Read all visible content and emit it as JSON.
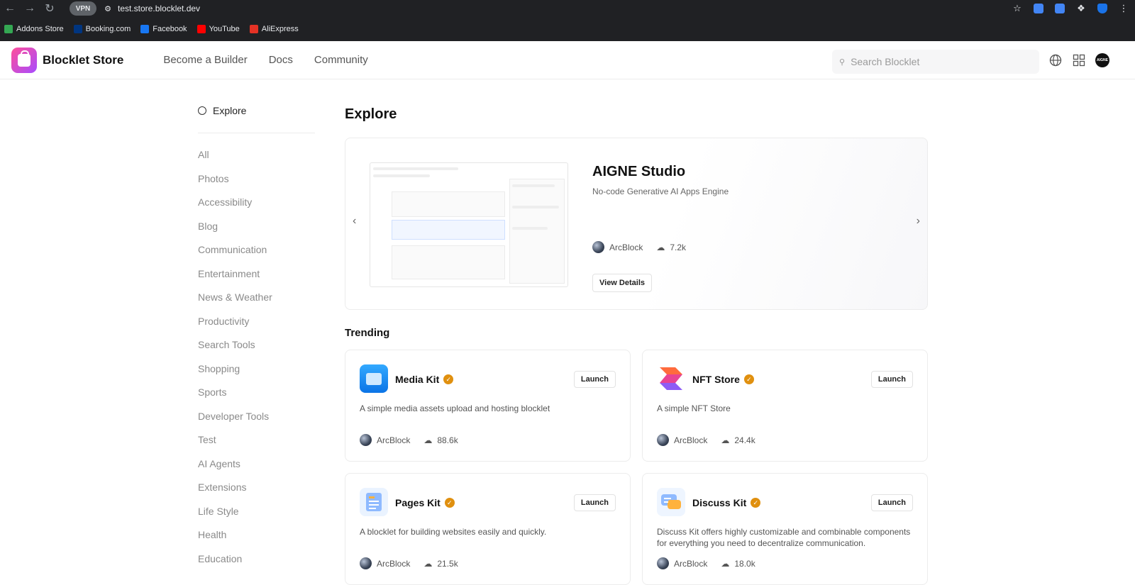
{
  "browser": {
    "vpn_label": "VPN",
    "url": "test.store.blocklet.dev",
    "bookmarks": [
      {
        "label": "Addons Store",
        "color": "#34a853"
      },
      {
        "label": "Booking.com",
        "color": "#003580"
      },
      {
        "label": "Facebook",
        "color": "#1877f2"
      },
      {
        "label": "YouTube",
        "color": "#ff0000"
      },
      {
        "label": "AliExpress",
        "color": "#e43225"
      }
    ]
  },
  "header": {
    "brand": "Blocklet Store",
    "nav": [
      "Become a Builder",
      "Docs",
      "Community"
    ],
    "search_placeholder": "Search Blocklet",
    "avatar_text": "AIGNE"
  },
  "sidebar": {
    "heading": "Explore",
    "categories": [
      "All",
      "Photos",
      "Accessibility",
      "Blog",
      "Communication",
      "Entertainment",
      "News & Weather",
      "Productivity",
      "Search Tools",
      "Shopping",
      "Sports",
      "Developer Tools",
      "Test",
      "AI Agents",
      "Extensions",
      "Life Style",
      "Health",
      "Education"
    ]
  },
  "main": {
    "title": "Explore",
    "featured": {
      "name": "AIGNE Studio",
      "subtitle": "No-code Generative AI Apps Engine",
      "author": "ArcBlock",
      "downloads": "7.2k",
      "button": "View Details"
    },
    "trending_title": "Trending",
    "apps": [
      {
        "name": "Media Kit",
        "desc": "A simple media assets upload and hosting blocklet",
        "author": "ArcBlock",
        "downloads": "88.6k",
        "button": "Launch"
      },
      {
        "name": "NFT Store",
        "desc": "A simple NFT Store",
        "author": "ArcBlock",
        "downloads": "24.4k",
        "button": "Launch"
      },
      {
        "name": "Pages Kit",
        "desc": "A blocklet for building websites easily and quickly.",
        "author": "ArcBlock",
        "downloads": "21.5k",
        "button": "Launch"
      },
      {
        "name": "Discuss Kit",
        "desc": "Discuss Kit offers highly customizable and combinable components for everything you need to decentralize communication.",
        "author": "ArcBlock",
        "downloads": "18.0k",
        "button": "Launch"
      }
    ]
  }
}
